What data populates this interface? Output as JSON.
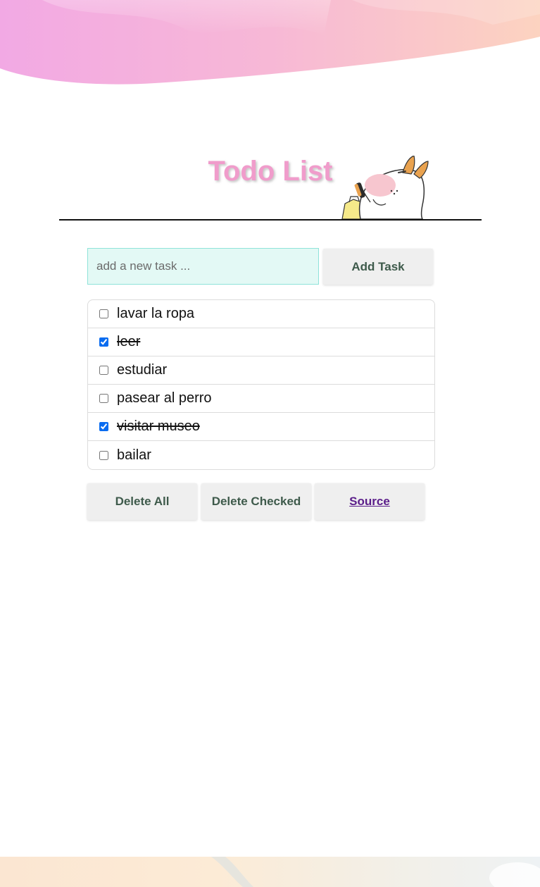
{
  "header": {
    "title": "Todo List"
  },
  "add_task": {
    "placeholder": "add a new task ...",
    "value": "",
    "button_label": "Add Task"
  },
  "tasks": [
    {
      "label": "lavar la ropa",
      "checked": false
    },
    {
      "label": "leer",
      "checked": true
    },
    {
      "label": "estudiar",
      "checked": false
    },
    {
      "label": "pasear al perro",
      "checked": false
    },
    {
      "label": "visitar museo",
      "checked": true
    },
    {
      "label": "bailar",
      "checked": false
    }
  ],
  "footer": {
    "delete_all_label": "Delete All",
    "delete_checked_label": "Delete Checked",
    "source_label": "Source"
  },
  "colors": {
    "title": "#f09ccb",
    "input_background": "#e3f9f5",
    "button_background": "#efefef",
    "button_text": "#3e5a4b",
    "link": "#5b1e8a",
    "checkbox_accent": "#0a6cf0"
  },
  "icons": {
    "mascot": "dog-eating-icon"
  }
}
